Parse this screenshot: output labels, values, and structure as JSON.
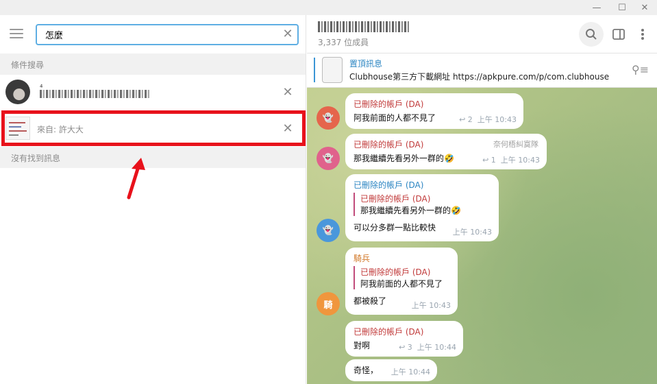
{
  "window": {
    "minimize": "—",
    "maximize": "☐",
    "close": "✕"
  },
  "left": {
    "search_value": "怎麼",
    "section_conditions": "條件搜尋",
    "result_from": "來自: 許大大",
    "no_messages": "沒有找到訊息"
  },
  "chat": {
    "members": "3,337 位成員",
    "pinned_title": "置頂訊息",
    "pinned_text": "Clubhouse第三方下載網址 https://apkpure.com/p/com.clubhouse"
  },
  "messages": [
    {
      "sender": "已刪除的帳戶 (DA)",
      "text": "阿我前面的人都不見了",
      "replies": "2",
      "time": "上午 10:43",
      "avatar_color": "#e5654c"
    },
    {
      "sender": "已刪除的帳戶 (DA)",
      "tag": "奈何梧糾寞隊",
      "text": "那我繼續先看另外一群的🤣",
      "replies": "1",
      "time": "上午 10:43",
      "avatar_color": "#e0628c"
    },
    {
      "sender": "已刪除的帳戶 (DA)",
      "quote_name": "已刪除的帳戶 (DA)",
      "quote_text": "那我繼續先看另外一群的🤣",
      "text": "可以分多群一點比較快",
      "time": "上午 10:43",
      "avatar_color": "#4a97db"
    },
    {
      "sender": "騎兵",
      "avatar_letter": "騎",
      "quote_name": "已刪除的帳戶 (DA)",
      "quote_text": "阿我前面的人都不見了",
      "text": "都被殺了",
      "time": "上午 10:43",
      "avatar_color": "#f0963d"
    },
    {
      "sender": "已刪除的帳戶 (DA)",
      "text": "對啊",
      "replies": "3",
      "time": "上午 10:44",
      "avatar_color": "#e5654c"
    },
    {
      "text": "奇怪，",
      "time": "上午 10:44"
    }
  ],
  "icons": {
    "reply": "↩",
    "ghost": "👻"
  },
  "colors": {
    "accent": "#5eaee3",
    "highlight": "#e8111b",
    "deleted_name": "#c13a3a",
    "blue_name": "#2b85c2",
    "orange_name": "#d2792a"
  }
}
